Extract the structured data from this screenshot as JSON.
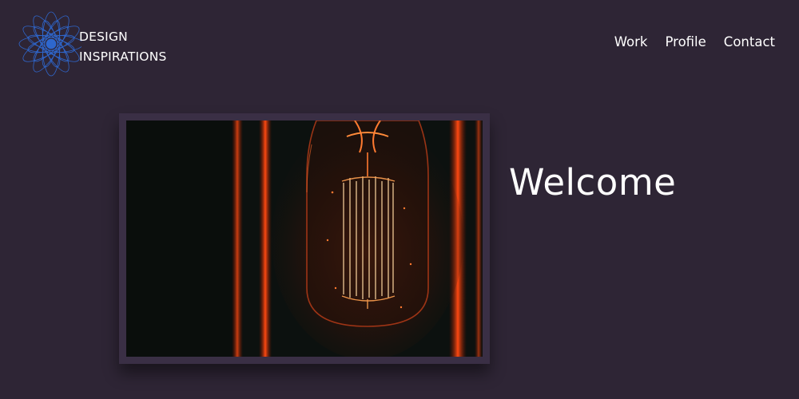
{
  "brand": {
    "line1": "DESIGN",
    "line2": "INSPIRATIONS",
    "logo_icon": "spiral-flower-icon",
    "logo_color": "#2f6bd6"
  },
  "nav": {
    "items": [
      {
        "label": "Work"
      },
      {
        "label": "Profile"
      },
      {
        "label": "Contact"
      }
    ]
  },
  "hero": {
    "image": "edison-bulb-photo",
    "heading": "Welcome"
  },
  "colors": {
    "background": "#2e2535",
    "frame": "#3a2f45",
    "text": "#ffffff",
    "glow": "#ff4a12"
  }
}
